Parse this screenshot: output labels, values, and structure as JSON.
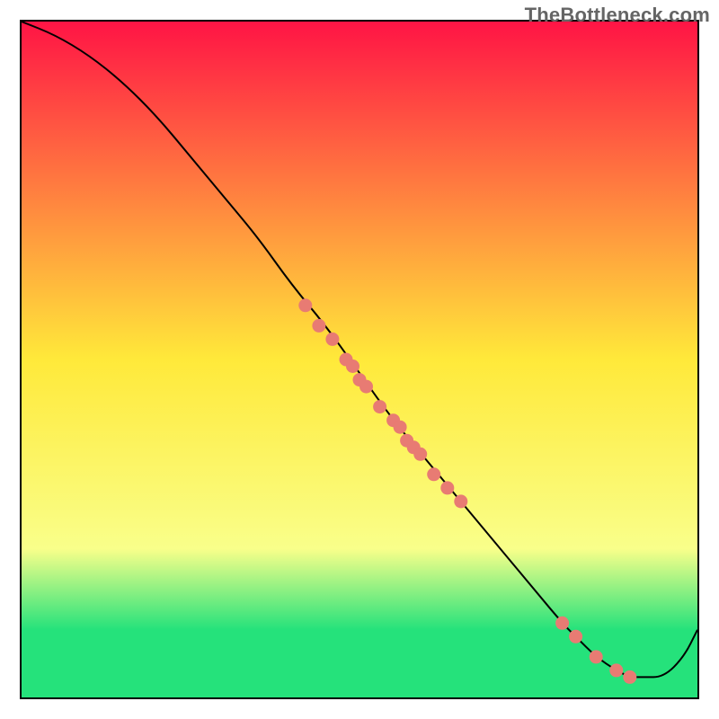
{
  "watermark": "TheBottleneck.com",
  "colors": {
    "top": "#ff1445",
    "mid": "#ffe93a",
    "low": "#f9ff8a",
    "band": "#25e27b",
    "border": "#000000",
    "curve": "#000000",
    "dot": "#e87b73"
  },
  "plot": {
    "viewbox_w": 752,
    "viewbox_h": 752
  },
  "chart_data": {
    "type": "line",
    "title": "",
    "xlabel": "",
    "ylabel": "",
    "xlim": [
      0,
      100
    ],
    "ylim": [
      0,
      100
    ],
    "annotation": "TheBottleneck.com",
    "series": [
      {
        "name": "bottleneck-curve",
        "x": [
          0,
          5,
          10,
          15,
          20,
          25,
          30,
          35,
          40,
          45,
          50,
          55,
          60,
          65,
          70,
          75,
          80,
          82,
          85,
          88,
          90,
          92,
          95,
          98,
          100
        ],
        "y": [
          100,
          98,
          95,
          91,
          86,
          80,
          74,
          68,
          61,
          55,
          48,
          41,
          35,
          29,
          23,
          17,
          11,
          9,
          6,
          4,
          3,
          3,
          3,
          6,
          10
        ]
      }
    ],
    "markers": [
      {
        "x": 42,
        "y": 58
      },
      {
        "x": 44,
        "y": 55
      },
      {
        "x": 46,
        "y": 53
      },
      {
        "x": 48,
        "y": 50
      },
      {
        "x": 49,
        "y": 49
      },
      {
        "x": 50,
        "y": 47
      },
      {
        "x": 51,
        "y": 46
      },
      {
        "x": 53,
        "y": 43
      },
      {
        "x": 55,
        "y": 41
      },
      {
        "x": 56,
        "y": 40
      },
      {
        "x": 57,
        "y": 38
      },
      {
        "x": 58,
        "y": 37
      },
      {
        "x": 59,
        "y": 36
      },
      {
        "x": 61,
        "y": 33
      },
      {
        "x": 63,
        "y": 31
      },
      {
        "x": 65,
        "y": 29
      },
      {
        "x": 80,
        "y": 11
      },
      {
        "x": 82,
        "y": 9
      },
      {
        "x": 85,
        "y": 6
      },
      {
        "x": 88,
        "y": 4
      },
      {
        "x": 90,
        "y": 3
      }
    ],
    "gradient_stops": [
      {
        "pos": 0.0,
        "color": "#ff1445"
      },
      {
        "pos": 0.5,
        "color": "#ffe93a"
      },
      {
        "pos": 0.78,
        "color": "#f9ff8a"
      },
      {
        "pos": 0.9,
        "color": "#25e27b"
      },
      {
        "pos": 1.0,
        "color": "#25e27b"
      }
    ]
  }
}
